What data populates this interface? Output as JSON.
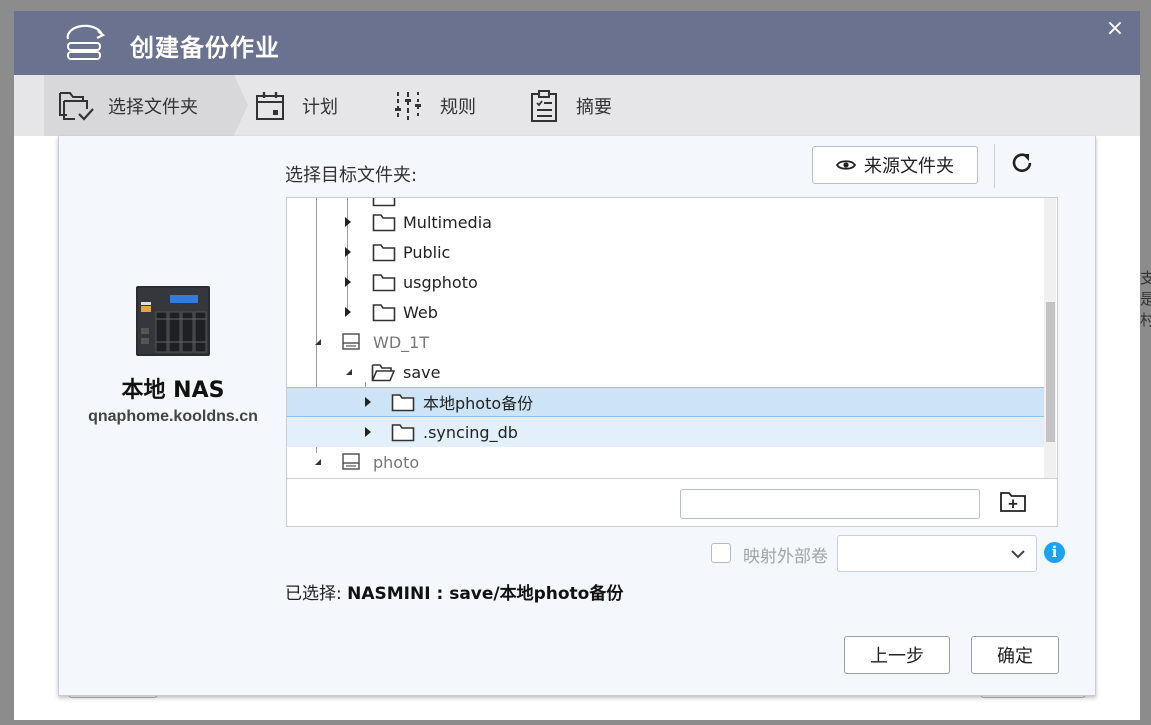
{
  "window": {
    "title": "创建备份作业",
    "close_glyph": "×"
  },
  "stepper": {
    "steps": [
      {
        "label": "选择文件夹",
        "icon": "folder-check-icon",
        "active": true
      },
      {
        "label": "计划",
        "icon": "calendar-icon",
        "active": false
      },
      {
        "label": "规则",
        "icon": "sliders-icon",
        "active": false
      },
      {
        "label": "摘要",
        "icon": "clipboard-icon",
        "active": false
      }
    ]
  },
  "source": {
    "device_title": "本地 NAS",
    "hostname": "qnaphome.kooldns.cn"
  },
  "target": {
    "label": "选择目标文件夹:",
    "source_folder_button": "来源文件夹",
    "tree": [
      {
        "label": "Multimedia",
        "type": "folder",
        "state": "collapsed"
      },
      {
        "label": "Public",
        "type": "folder",
        "state": "collapsed"
      },
      {
        "label": "usgphoto",
        "type": "folder",
        "state": "collapsed"
      },
      {
        "label": "Web",
        "type": "folder",
        "state": "collapsed"
      },
      {
        "label": "WD_1T",
        "type": "volume",
        "state": "expanded"
      },
      {
        "label": "save",
        "type": "folder",
        "state": "expanded"
      },
      {
        "label": "本地photo备份",
        "type": "folder",
        "state": "collapsed",
        "selected": true
      },
      {
        "label": ".syncing_db",
        "type": "folder",
        "state": "collapsed"
      },
      {
        "label": "photo",
        "type": "volume",
        "state": "expanded"
      }
    ],
    "new_folder_input": {
      "value": "",
      "placeholder": ""
    }
  },
  "map_external": {
    "label": "映射外部卷",
    "checked": false,
    "selected_value": ""
  },
  "selection": {
    "prefix": "已选择:",
    "path": "NASMINI : save/本地photo备份"
  },
  "buttons": {
    "prev": "上一步",
    "ok": "确定"
  },
  "background_fragment": "支\n是\n村",
  "colors": {
    "header": "#6b7290",
    "stepper": "#e6e6e8",
    "selected_row": "#cde4f7",
    "info": "#1da1f2"
  }
}
